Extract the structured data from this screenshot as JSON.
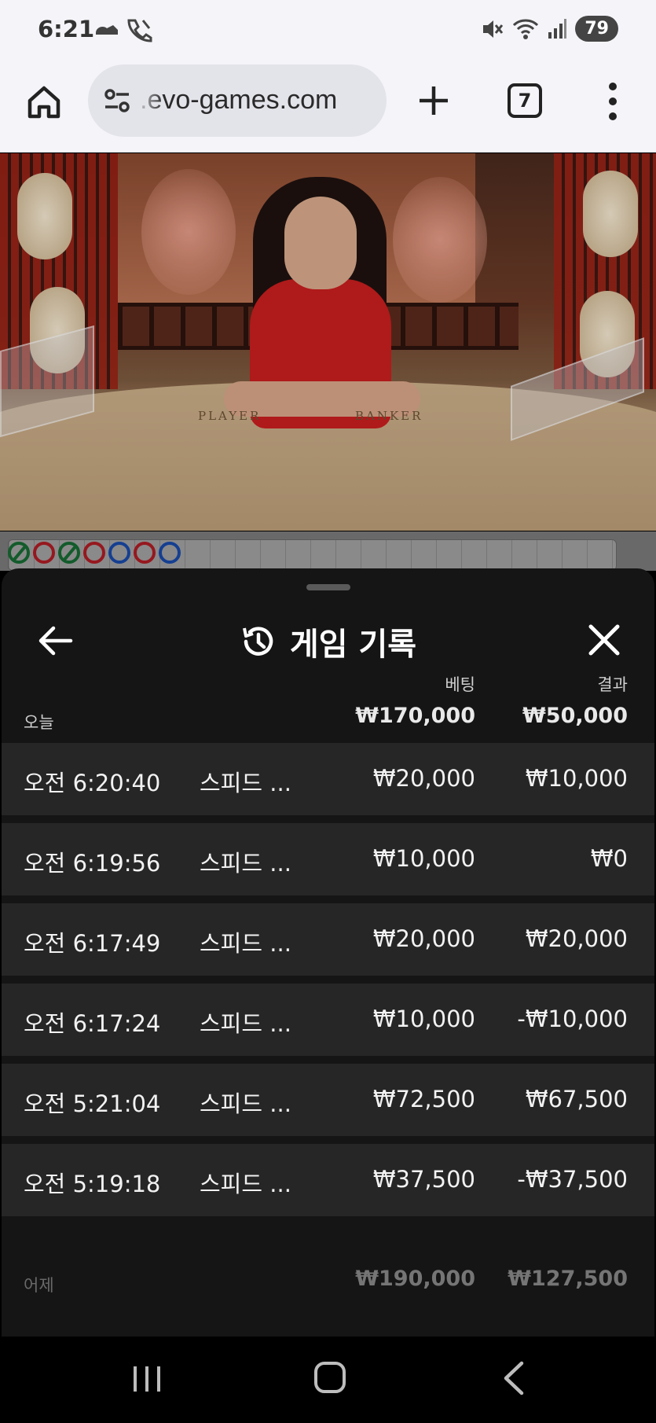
{
  "status_bar": {
    "time": "6:21",
    "battery": "79",
    "icons": [
      "cloud-shoe-icon",
      "wifi-calling-icon",
      "mute-icon",
      "wifi-icon",
      "signal-icon"
    ]
  },
  "browser": {
    "url": ".evo-games.com",
    "tab_count": "7",
    "icons": [
      "home-icon",
      "site-settings-icon",
      "plus-icon",
      "tabs-icon",
      "more-vert-icon"
    ]
  },
  "video": {
    "table_labels": {
      "player": "PLAYER",
      "banker": "BANKER"
    }
  },
  "roadmap": {
    "beads": [
      "green-slash",
      "red",
      "green-slash",
      "red",
      "blue",
      "red",
      "blue"
    ]
  },
  "history_sheet": {
    "title": "게임 기록",
    "columns": {
      "bet": "베팅",
      "result": "결과"
    },
    "today": {
      "label": "오늘",
      "total_bet": "₩170,000",
      "total_result": "₩50,000"
    },
    "rows": [
      {
        "time": "오전 6:20:40",
        "game": "스피드 ...",
        "bet": "₩20,000",
        "result": "₩10,000"
      },
      {
        "time": "오전 6:19:56",
        "game": "스피드 ...",
        "bet": "₩10,000",
        "result": "₩0"
      },
      {
        "time": "오전 6:17:49",
        "game": "스피드 ...",
        "bet": "₩20,000",
        "result": "₩20,000"
      },
      {
        "time": "오전 6:17:24",
        "game": "스피드 ...",
        "bet": "₩10,000",
        "result": "-₩10,000"
      },
      {
        "time": "오전 5:21:04",
        "game": "스피드 ...",
        "bet": "₩72,500",
        "result": "₩67,500"
      },
      {
        "time": "오전 5:19:18",
        "game": "스피드 ...",
        "bet": "₩37,500",
        "result": "-₩37,500"
      }
    ],
    "yesterday": {
      "label": "어제",
      "total_bet": "₩190,000",
      "total_result": "₩127,500"
    }
  },
  "colors": {
    "sheet_bg": "#151515",
    "row_bg": "#262626",
    "text_primary": "#f2f2f2",
    "text_secondary": "#cfcfcf"
  }
}
